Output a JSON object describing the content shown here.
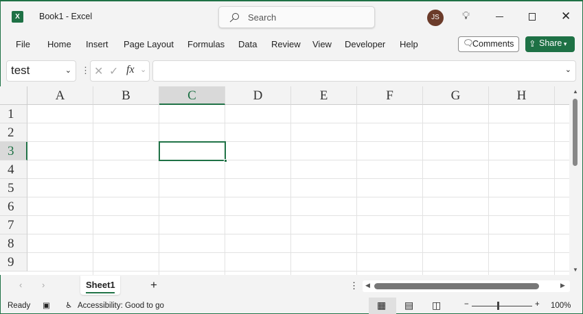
{
  "titlebar": {
    "app_title": "Book1  -  Excel",
    "search_placeholder": "Search",
    "avatar_initials": "JS"
  },
  "menu": [
    "File",
    "Home",
    "Insert",
    "Page Layout",
    "Formulas",
    "Data",
    "Review",
    "View",
    "Developer",
    "Help"
  ],
  "buttons": {
    "comments": "Comments",
    "share": "Share"
  },
  "formula_bar": {
    "name_box": "test",
    "fx": "fx",
    "formula": ""
  },
  "columns": [
    "A",
    "B",
    "C",
    "D",
    "E",
    "F",
    "G",
    "H"
  ],
  "rows": [
    "1",
    "2",
    "3",
    "4",
    "5",
    "6",
    "7",
    "8",
    "9"
  ],
  "selected_cell": "C3",
  "sheets": [
    {
      "name": "Sheet1",
      "active": true
    }
  ],
  "status": {
    "ready": "Ready",
    "accessibility": "Accessibility: Good to go",
    "zoom": "100%",
    "zoom_level_percent": 100
  },
  "colors": {
    "accent": "#1e7145"
  }
}
